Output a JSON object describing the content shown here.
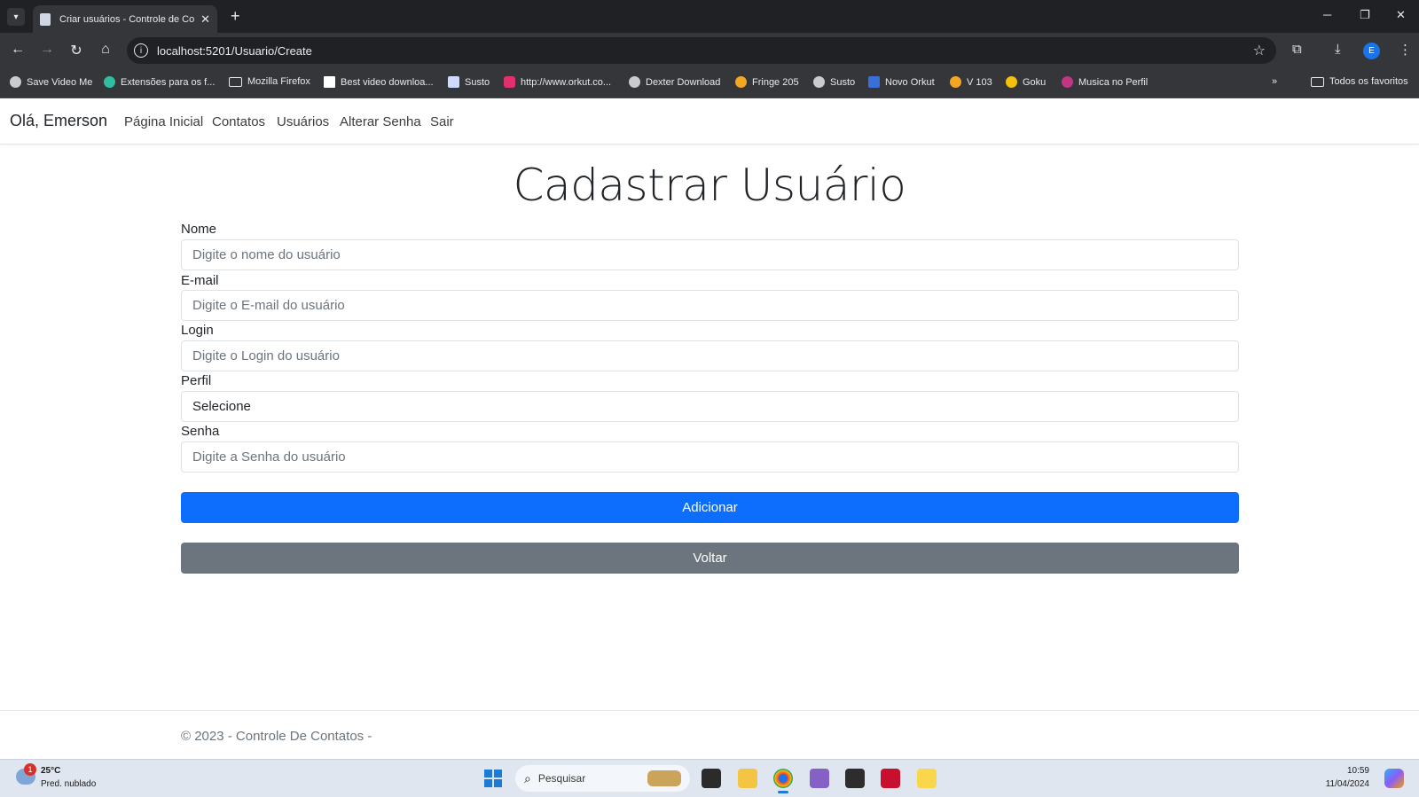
{
  "browser": {
    "tab_title": "Criar usuários - Controle de Contatos",
    "url": "localhost:5201/Usuario/Create",
    "bookmarks": [
      {
        "label": "Save Video Me",
        "icon": "globe-icon",
        "color": "#e8eaed"
      },
      {
        "label": "Extensões para os f...",
        "icon": "puzzle-icon",
        "color": "#2fbfa0"
      },
      {
        "label": "Mozilla Firefox",
        "icon": "folder-icon",
        "color": "#e8eaed"
      },
      {
        "label": "Best video downloa...",
        "icon": "page-icon",
        "color": "#ffffff"
      },
      {
        "label": "Susto",
        "icon": "camera-icon",
        "color": "#cfd8ff"
      },
      {
        "label": "http://www.orkut.co...",
        "icon": "instagram-icon",
        "color": "#e1306c"
      },
      {
        "label": "Dexter Download",
        "icon": "globe-icon",
        "color": "#e8eaed"
      },
      {
        "label": "Fringe 205",
        "icon": "m-icon",
        "color": "#f5a623"
      },
      {
        "label": "Susto",
        "icon": "globe-icon",
        "color": "#e8eaed"
      },
      {
        "label": "Novo Orkut",
        "icon": "b-icon",
        "color": "#3a6fd8"
      },
      {
        "label": "V 103",
        "icon": "m-icon",
        "color": "#f5a623"
      },
      {
        "label": "Goku",
        "icon": "pinwheel-icon",
        "color": "#f4c20d"
      },
      {
        "label": "Musica no Perfil",
        "icon": "ring-icon",
        "color": "#c13584"
      }
    ],
    "all_bookmarks_label": "Todos os favoritos",
    "profile_initial": "E"
  },
  "app": {
    "greeting": "Olá, Emerson",
    "nav": [
      "Página Inicial",
      "Contatos",
      "Usuários",
      "Alterar Senha",
      "Sair"
    ]
  },
  "form": {
    "title": "Cadastrar Usuário",
    "fields": {
      "nome": {
        "label": "Nome",
        "placeholder": "Digite o nome do usuário"
      },
      "email": {
        "label": "E-mail",
        "placeholder": "Digite o E-mail do usuário"
      },
      "login": {
        "label": "Login",
        "placeholder": "Digite o Login do usuário"
      },
      "perfil": {
        "label": "Perfil",
        "selected": "Selecione"
      },
      "senha": {
        "label": "Senha",
        "placeholder": "Digite a Senha do usuário"
      }
    },
    "submit_label": "Adicionar",
    "back_label": "Voltar"
  },
  "footer": {
    "text": "© 2023 - Controle De Contatos -"
  },
  "taskbar": {
    "weather_badge": "1",
    "temperature": "25°C",
    "weather_desc": "Pred. nublado",
    "search_placeholder": "Pesquisar",
    "time": "10:59",
    "date": "11/04/2024"
  },
  "colors": {
    "primary": "#0d6efd",
    "secondary": "#6c757d"
  }
}
